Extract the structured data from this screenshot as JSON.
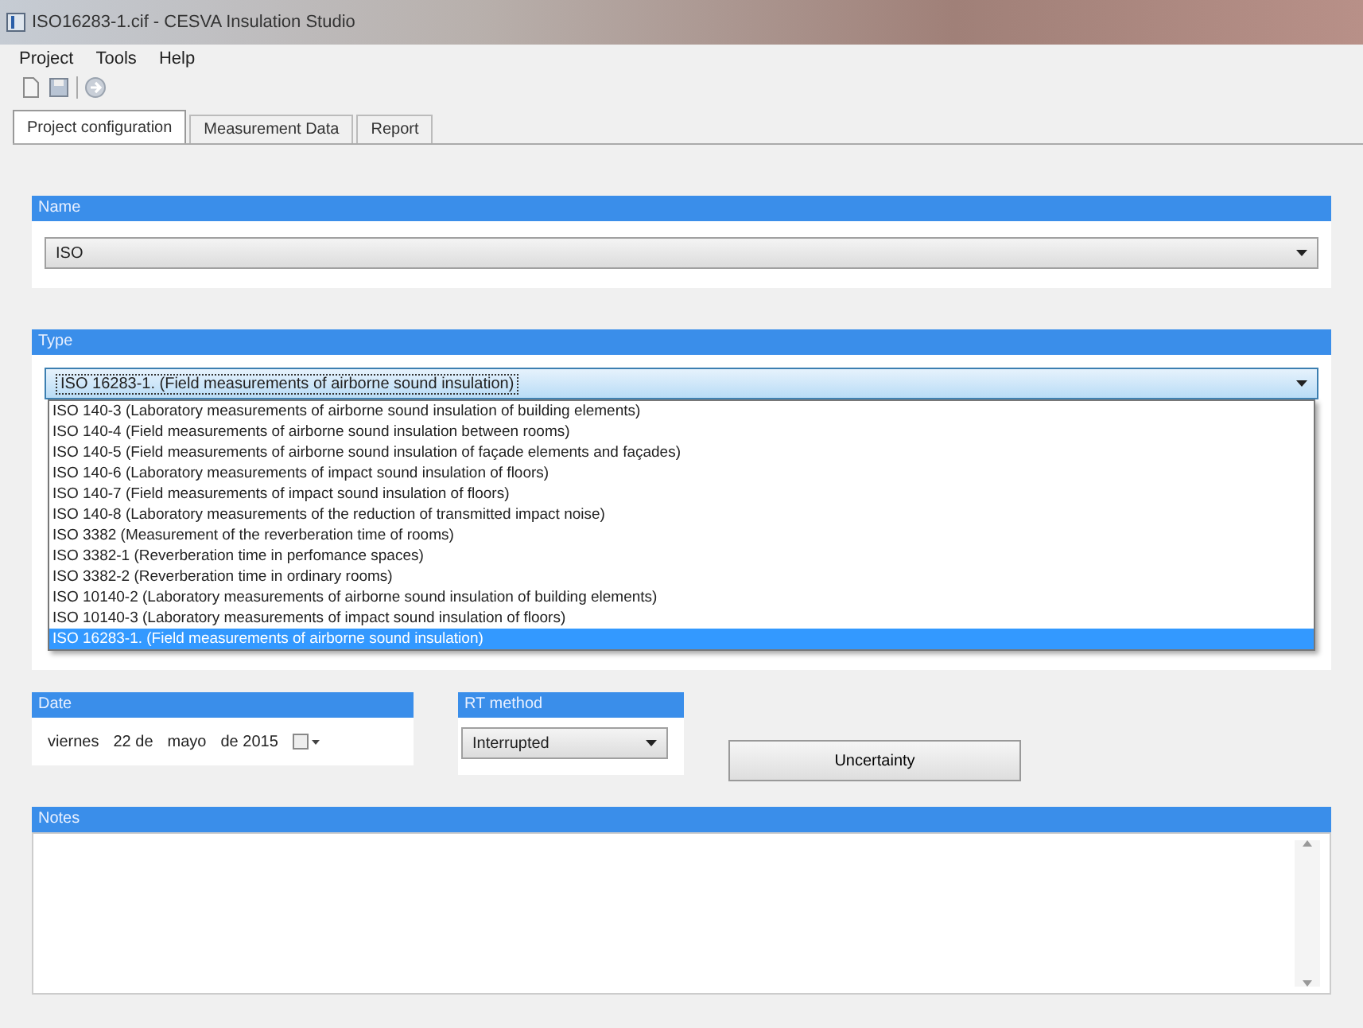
{
  "window": {
    "title": "ISO16283-1.cif - CESVA Insulation Studio"
  },
  "menu": [
    "Project",
    "Tools",
    "Help"
  ],
  "tabs": [
    {
      "label": "Project configuration",
      "selected": true
    },
    {
      "label": "Measurement Data",
      "selected": false
    },
    {
      "label": "Report",
      "selected": false
    }
  ],
  "name_section": {
    "header": "Name",
    "value": "ISO"
  },
  "type_section": {
    "header": "Type",
    "value": "ISO 16283-1. (Field measurements of airborne sound insulation)",
    "expanded": true,
    "options": [
      {
        "label": "ISO 140-3 (Laboratory measurements of airborne sound insulation of building elements)",
        "selected": false
      },
      {
        "label": "ISO 140-4 (Field measurements of airborne sound insulation between rooms)",
        "selected": false
      },
      {
        "label": "ISO 140-5 (Field measurements of airborne sound insulation of façade elements and façades)",
        "selected": false
      },
      {
        "label": "ISO 140-6 (Laboratory measurements of impact sound insulation of floors)",
        "selected": false
      },
      {
        "label": "ISO 140-7 (Field measurements of impact sound insulation of floors)",
        "selected": false
      },
      {
        "label": "ISO 140-8 (Laboratory measurements of the reduction of transmitted impact noise)",
        "selected": false
      },
      {
        "label": "ISO 3382 (Measurement of the reverberation time of rooms)",
        "selected": false
      },
      {
        "label": "ISO 3382-1 (Reverberation time in perfomance spaces)",
        "selected": false
      },
      {
        "label": "ISO 3382-2 (Reverberation time in ordinary rooms)",
        "selected": false
      },
      {
        "label": "ISO 10140-2 (Laboratory measurements of airborne sound insulation of building elements)",
        "selected": false
      },
      {
        "label": "ISO 10140-3 (Laboratory measurements of impact sound insulation of floors)",
        "selected": false
      },
      {
        "label": "ISO 16283-1. (Field measurements of airborne sound insulation)",
        "selected": true
      }
    ]
  },
  "date_section": {
    "header": "Date",
    "weekday": "viernes",
    "day": "22 de",
    "month": "mayo",
    "year": "de 2015"
  },
  "rt_section": {
    "header": "RT method",
    "value": "Interrupted"
  },
  "uncertainty_button": "Uncertainty",
  "notes_section": {
    "header": "Notes"
  }
}
